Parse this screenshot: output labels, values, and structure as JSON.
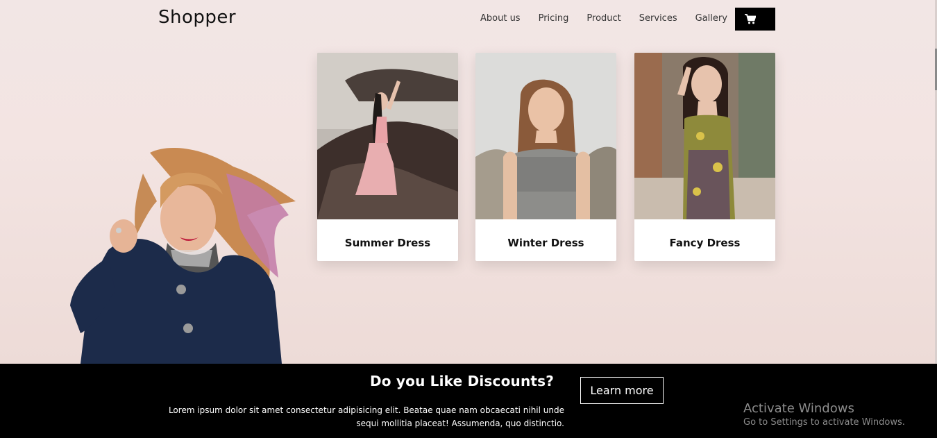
{
  "header": {
    "logo": "Shopper",
    "nav": [
      "About us",
      "Pricing",
      "Product",
      "Services",
      "Gallery"
    ],
    "cart_icon": "cart-icon"
  },
  "cards": [
    {
      "title": "Summer Dress"
    },
    {
      "title": "Winter Dress"
    },
    {
      "title": "Fancy Dress"
    }
  ],
  "promo": {
    "title": "Do you Like Discounts?",
    "button": "Learn more",
    "text": "Lorem ipsum dolor sit amet consectetur adipisicing elit. Beatae quae nam obcaecati nihil unde sequi mollitia placeat! Assumenda, quo distinctio."
  },
  "watermark": {
    "line1": "Activate Windows",
    "line2": "Go to Settings to activate Windows."
  },
  "colors": {
    "hero_bg": "#f2e6e5",
    "promo_bg": "#000000",
    "text": "#111111"
  }
}
